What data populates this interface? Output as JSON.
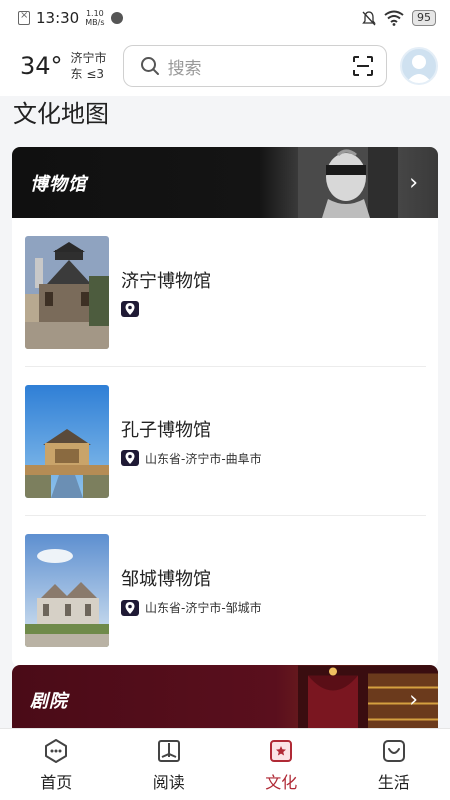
{
  "status_bar": {
    "time": "13:30",
    "net_speed_value": "1.10",
    "net_speed_unit": "MB/s",
    "battery": "95"
  },
  "header": {
    "temperature": "34°",
    "city": "济宁市",
    "wind": "东 ≤3",
    "search_placeholder": "搜索"
  },
  "page": {
    "title": "文化地图"
  },
  "museums": {
    "section_title": "博物馆",
    "items": [
      {
        "name": "济宁博物馆",
        "location": ""
      },
      {
        "name": "孔子博物馆",
        "location": "山东省-济宁市-曲阜市"
      },
      {
        "name": "邹城博物馆",
        "location": "山东省-济宁市-邹城市"
      }
    ]
  },
  "theater": {
    "section_title": "剧院"
  },
  "bottom_nav": {
    "items": [
      {
        "label": "首页",
        "icon": "home-icon"
      },
      {
        "label": "阅读",
        "icon": "book-icon"
      },
      {
        "label": "文化",
        "icon": "culture-icon",
        "active": true
      },
      {
        "label": "生活",
        "icon": "life-icon"
      }
    ]
  },
  "colors": {
    "accent": "#b02a36",
    "museum_banner": "#111111",
    "theater_banner": "#4a0b17"
  }
}
